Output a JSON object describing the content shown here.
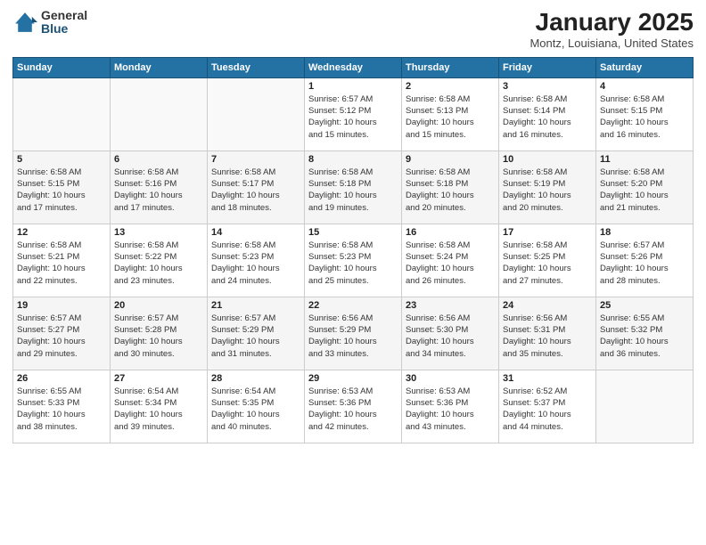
{
  "logo": {
    "general": "General",
    "blue": "Blue"
  },
  "header": {
    "title": "January 2025",
    "location": "Montz, Louisiana, United States"
  },
  "days_of_week": [
    "Sunday",
    "Monday",
    "Tuesday",
    "Wednesday",
    "Thursday",
    "Friday",
    "Saturday"
  ],
  "weeks": [
    [
      {
        "day": "",
        "info": ""
      },
      {
        "day": "",
        "info": ""
      },
      {
        "day": "",
        "info": ""
      },
      {
        "day": "1",
        "info": "Sunrise: 6:57 AM\nSunset: 5:12 PM\nDaylight: 10 hours\nand 15 minutes."
      },
      {
        "day": "2",
        "info": "Sunrise: 6:58 AM\nSunset: 5:13 PM\nDaylight: 10 hours\nand 15 minutes."
      },
      {
        "day": "3",
        "info": "Sunrise: 6:58 AM\nSunset: 5:14 PM\nDaylight: 10 hours\nand 16 minutes."
      },
      {
        "day": "4",
        "info": "Sunrise: 6:58 AM\nSunset: 5:15 PM\nDaylight: 10 hours\nand 16 minutes."
      }
    ],
    [
      {
        "day": "5",
        "info": "Sunrise: 6:58 AM\nSunset: 5:15 PM\nDaylight: 10 hours\nand 17 minutes."
      },
      {
        "day": "6",
        "info": "Sunrise: 6:58 AM\nSunset: 5:16 PM\nDaylight: 10 hours\nand 17 minutes."
      },
      {
        "day": "7",
        "info": "Sunrise: 6:58 AM\nSunset: 5:17 PM\nDaylight: 10 hours\nand 18 minutes."
      },
      {
        "day": "8",
        "info": "Sunrise: 6:58 AM\nSunset: 5:18 PM\nDaylight: 10 hours\nand 19 minutes."
      },
      {
        "day": "9",
        "info": "Sunrise: 6:58 AM\nSunset: 5:18 PM\nDaylight: 10 hours\nand 20 minutes."
      },
      {
        "day": "10",
        "info": "Sunrise: 6:58 AM\nSunset: 5:19 PM\nDaylight: 10 hours\nand 20 minutes."
      },
      {
        "day": "11",
        "info": "Sunrise: 6:58 AM\nSunset: 5:20 PM\nDaylight: 10 hours\nand 21 minutes."
      }
    ],
    [
      {
        "day": "12",
        "info": "Sunrise: 6:58 AM\nSunset: 5:21 PM\nDaylight: 10 hours\nand 22 minutes."
      },
      {
        "day": "13",
        "info": "Sunrise: 6:58 AM\nSunset: 5:22 PM\nDaylight: 10 hours\nand 23 minutes."
      },
      {
        "day": "14",
        "info": "Sunrise: 6:58 AM\nSunset: 5:23 PM\nDaylight: 10 hours\nand 24 minutes."
      },
      {
        "day": "15",
        "info": "Sunrise: 6:58 AM\nSunset: 5:23 PM\nDaylight: 10 hours\nand 25 minutes."
      },
      {
        "day": "16",
        "info": "Sunrise: 6:58 AM\nSunset: 5:24 PM\nDaylight: 10 hours\nand 26 minutes."
      },
      {
        "day": "17",
        "info": "Sunrise: 6:58 AM\nSunset: 5:25 PM\nDaylight: 10 hours\nand 27 minutes."
      },
      {
        "day": "18",
        "info": "Sunrise: 6:57 AM\nSunset: 5:26 PM\nDaylight: 10 hours\nand 28 minutes."
      }
    ],
    [
      {
        "day": "19",
        "info": "Sunrise: 6:57 AM\nSunset: 5:27 PM\nDaylight: 10 hours\nand 29 minutes."
      },
      {
        "day": "20",
        "info": "Sunrise: 6:57 AM\nSunset: 5:28 PM\nDaylight: 10 hours\nand 30 minutes."
      },
      {
        "day": "21",
        "info": "Sunrise: 6:57 AM\nSunset: 5:29 PM\nDaylight: 10 hours\nand 31 minutes."
      },
      {
        "day": "22",
        "info": "Sunrise: 6:56 AM\nSunset: 5:29 PM\nDaylight: 10 hours\nand 33 minutes."
      },
      {
        "day": "23",
        "info": "Sunrise: 6:56 AM\nSunset: 5:30 PM\nDaylight: 10 hours\nand 34 minutes."
      },
      {
        "day": "24",
        "info": "Sunrise: 6:56 AM\nSunset: 5:31 PM\nDaylight: 10 hours\nand 35 minutes."
      },
      {
        "day": "25",
        "info": "Sunrise: 6:55 AM\nSunset: 5:32 PM\nDaylight: 10 hours\nand 36 minutes."
      }
    ],
    [
      {
        "day": "26",
        "info": "Sunrise: 6:55 AM\nSunset: 5:33 PM\nDaylight: 10 hours\nand 38 minutes."
      },
      {
        "day": "27",
        "info": "Sunrise: 6:54 AM\nSunset: 5:34 PM\nDaylight: 10 hours\nand 39 minutes."
      },
      {
        "day": "28",
        "info": "Sunrise: 6:54 AM\nSunset: 5:35 PM\nDaylight: 10 hours\nand 40 minutes."
      },
      {
        "day": "29",
        "info": "Sunrise: 6:53 AM\nSunset: 5:36 PM\nDaylight: 10 hours\nand 42 minutes."
      },
      {
        "day": "30",
        "info": "Sunrise: 6:53 AM\nSunset: 5:36 PM\nDaylight: 10 hours\nand 43 minutes."
      },
      {
        "day": "31",
        "info": "Sunrise: 6:52 AM\nSunset: 5:37 PM\nDaylight: 10 hours\nand 44 minutes."
      },
      {
        "day": "",
        "info": ""
      }
    ]
  ]
}
